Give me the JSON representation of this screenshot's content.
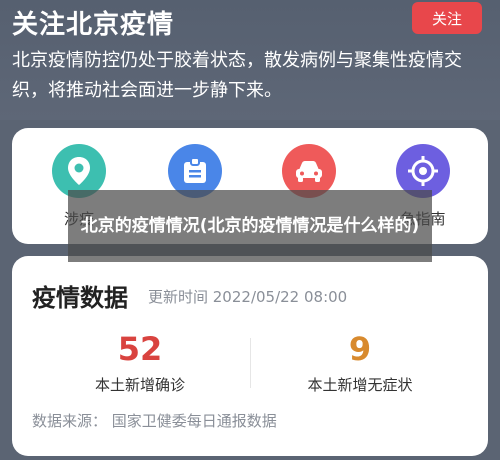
{
  "header": {
    "title": "关注北京疫情",
    "follow_button": "关注",
    "description": "北京疫情防控仍处于胶着状态，散发病例与聚集性疫情交织，将推动社会面进一步静下来。"
  },
  "shortcuts": [
    {
      "label": "涉疫",
      "icon": "location-pin-icon",
      "color": "#3dbfb0"
    },
    {
      "label": "",
      "icon": "id-badge-icon",
      "color": "#4a86e8"
    },
    {
      "label": "",
      "icon": "car-icon",
      "color": "#ef5a5a"
    },
    {
      "label": "急指南",
      "icon": "target-icon",
      "color": "#6d5fe0"
    }
  ],
  "overlay": {
    "caption": "北京的疫情情况(北京的疫情情况是什么样的)"
  },
  "stats": {
    "title": "疫情数据",
    "updated": "更新时间 2022/05/22 08:00",
    "items": [
      {
        "value": "52",
        "label": "本土新增确诊",
        "color": "#d9433f"
      },
      {
        "value": "9",
        "label": "本土新增无症状",
        "color": "#d88a2e"
      }
    ],
    "source": "数据来源：  国家卫健委每日通报数据"
  }
}
